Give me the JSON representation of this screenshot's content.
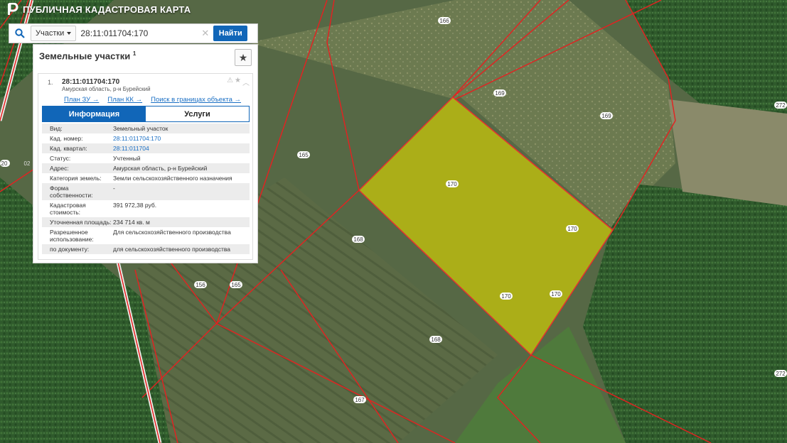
{
  "app": {
    "title": "ПУБЛИЧНАЯ КАДАСТРОВАЯ КАРТА"
  },
  "search": {
    "type_label": "Участки",
    "value": "28:11:011704:170",
    "find_label": "Найти"
  },
  "panel": {
    "title": "Земельные участки",
    "count": "1"
  },
  "card": {
    "num": "1.",
    "cad": "28:11:011704:170",
    "address": "Амурская область, р-н Бурейский",
    "links": [
      "План ЗУ →",
      "План КК →",
      "Поиск в границах объекта →"
    ],
    "tabs": [
      "Информация",
      "Услуги"
    ],
    "rows": [
      {
        "k": "Вид:",
        "v": "Земельный участок"
      },
      {
        "k": "Кад. номер:",
        "v": "28:11:011704:170"
      },
      {
        "k": "Кад. квартал:",
        "v": "28:11:011704"
      },
      {
        "k": "Статус:",
        "v": "Учтенный"
      },
      {
        "k": "Адрес:",
        "v": "Амурская область, р-н Бурейский"
      },
      {
        "k": "Категория земель:",
        "v": "Земли сельскохозяйственного назначения"
      },
      {
        "k": "Форма собственности:",
        "v": "-"
      },
      {
        "k": "Кадастровая стоимость:",
        "v": "391 972,38 руб."
      },
      {
        "k": "Уточненная площадь:",
        "v": "234 714 кв. м"
      },
      {
        "k": "Разрешенное использование:",
        "v": "Для сельскохозяйственного производства"
      },
      {
        "k": "по документу:",
        "v": "для сельскохозяйственного производства"
      }
    ]
  },
  "map": {
    "labels": [
      "166",
      "169",
      "169",
      "272",
      "165",
      "170",
      "170",
      "170",
      "170",
      "168",
      "156",
      "165",
      "168",
      "167",
      "272",
      "20",
      "02"
    ]
  }
}
